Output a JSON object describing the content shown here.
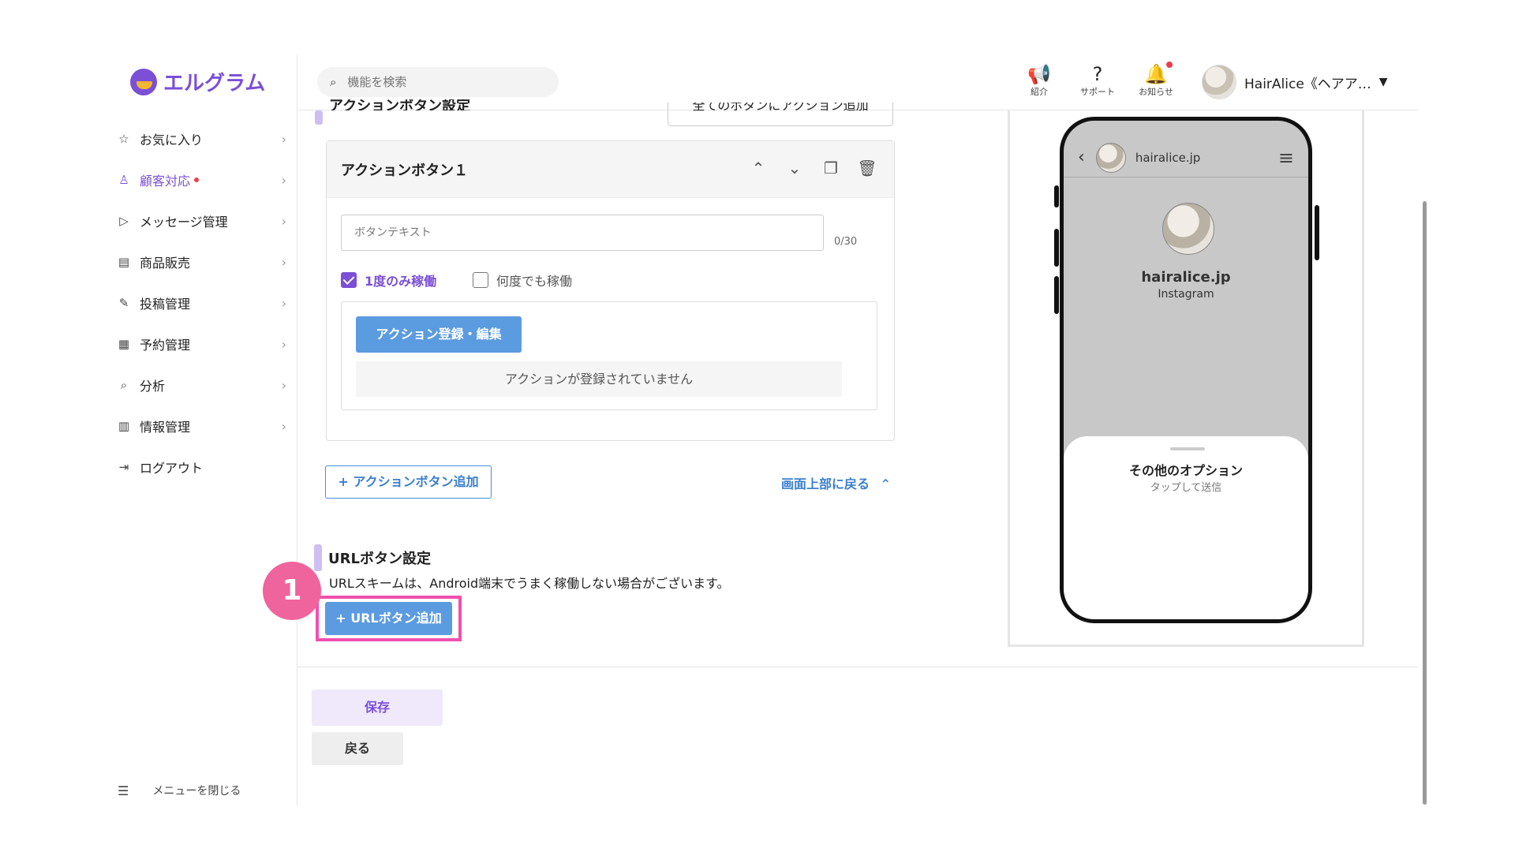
{
  "app": {
    "name": "エルグラム"
  },
  "sidebar": {
    "items": [
      {
        "label": "お気に入り",
        "icon": "star-icon",
        "glyph": "☆"
      },
      {
        "label": "顧客対応",
        "icon": "user-icon",
        "glyph": "♙",
        "active": true,
        "dot": true
      },
      {
        "label": "メッセージ管理",
        "icon": "send-icon",
        "glyph": "▷"
      },
      {
        "label": "商品販売",
        "icon": "store-icon",
        "glyph": "▤"
      },
      {
        "label": "投稿管理",
        "icon": "edit-icon",
        "glyph": "✎"
      },
      {
        "label": "予約管理",
        "icon": "calendar-icon",
        "glyph": "▦"
      },
      {
        "label": "分析",
        "icon": "report-icon",
        "glyph": "⌕"
      },
      {
        "label": "情報管理",
        "icon": "chart-icon",
        "glyph": "▥"
      },
      {
        "label": "ログアウト",
        "icon": "logout-icon",
        "glyph": "⇥"
      }
    ],
    "close_label": "メニューを閉じる"
  },
  "header": {
    "search_placeholder": "機能を検索",
    "icons": [
      {
        "label": "紹介",
        "icon": "megaphone-icon",
        "glyph": "📢"
      },
      {
        "label": "サポート",
        "icon": "help-icon",
        "glyph": "?"
      },
      {
        "label": "お知らせ",
        "icon": "bell-icon",
        "glyph": "🔔",
        "dot": true
      }
    ],
    "user_name": "HairAlice《ヘアア…"
  },
  "main": {
    "section_title_cut": "アクションボタン設定",
    "add_all_cut": "全てのボタンにアクション追加",
    "card": {
      "title": "アクションボタン１",
      "text_placeholder": "ボタンテキスト",
      "counter": "0/30",
      "check_once": "1度のみ稼働",
      "check_many": "何度でも稼働",
      "register_label": "アクション登録・編集",
      "empty_message": "アクションが登録されていません"
    },
    "add_action_label": "+ アクションボタン追加",
    "back_to_top_label": "画面上部に戻る",
    "url_section": {
      "title": "URLボタン設定",
      "description": "URLスキームは、Android端末でうまく稼働しない場合がございます。",
      "add_label": "+ URLボタン追加",
      "step_badge": "1"
    },
    "save_label": "保存",
    "back_label": "戻る"
  },
  "preview": {
    "handle": "hairalice.jp",
    "name": "hairalice.jp",
    "sub": "Instagram",
    "sheet_title": "その他のオプション",
    "sheet_sub": "タップして送信"
  },
  "colors": {
    "accent": "#7b4fd6",
    "button_blue": "#5b9be0",
    "highlight": "#f04fb0",
    "notify": "#ef3c4d"
  }
}
